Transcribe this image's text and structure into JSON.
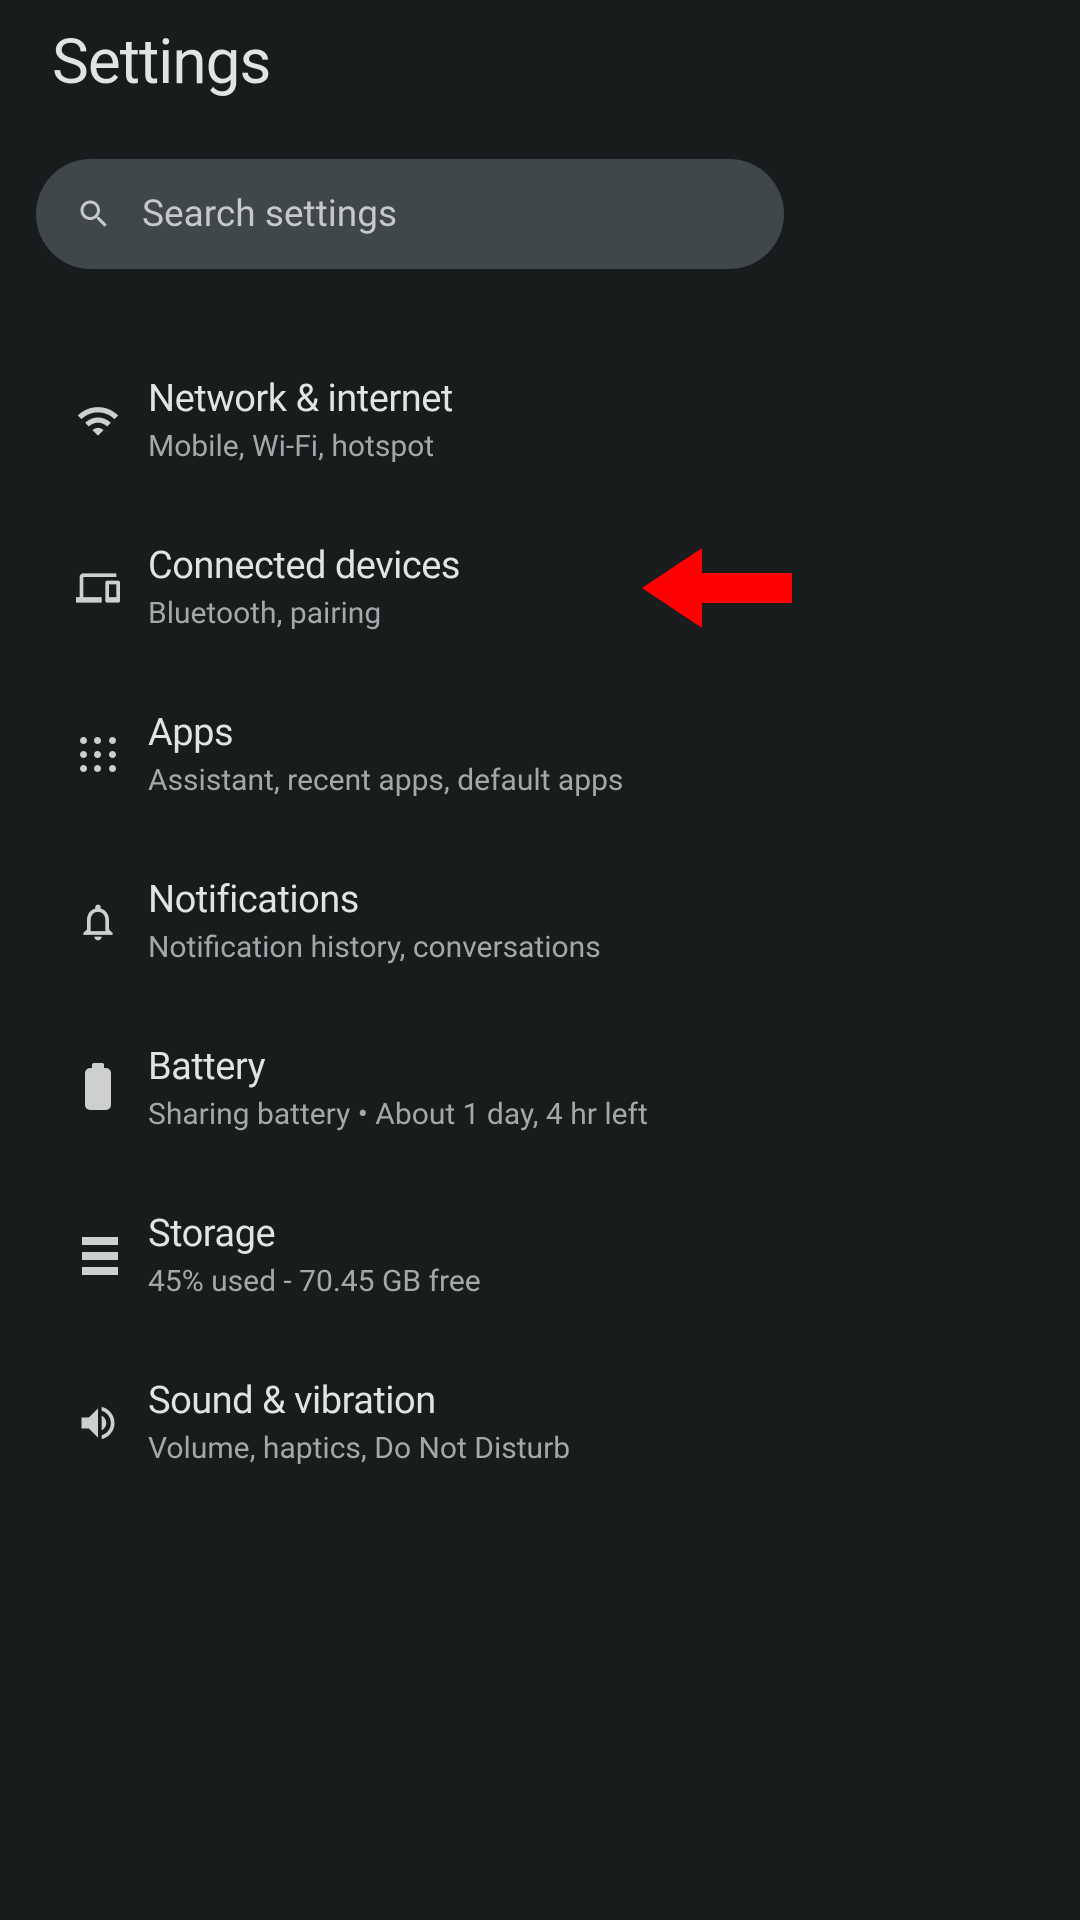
{
  "header": {
    "title": "Settings"
  },
  "search": {
    "placeholder": "Search settings"
  },
  "items": [
    {
      "icon": "wifi-icon",
      "title": "Network & internet",
      "subtitle": "Mobile, Wi-Fi, hotspot"
    },
    {
      "icon": "devices-icon",
      "title": "Connected devices",
      "subtitle": "Bluetooth, pairing"
    },
    {
      "icon": "apps-icon",
      "title": "Apps",
      "subtitle": "Assistant, recent apps, default apps"
    },
    {
      "icon": "bell-icon",
      "title": "Notifications",
      "subtitle": "Notification history, conversations"
    },
    {
      "icon": "battery-icon",
      "title": "Battery",
      "subtitle": "Sharing battery • About 1 day, 4 hr left"
    },
    {
      "icon": "storage-icon",
      "title": "Storage",
      "subtitle": "45% used - 70.45 GB free"
    },
    {
      "icon": "sound-icon",
      "title": "Sound & vibration",
      "subtitle": "Volume, haptics, Do Not Disturb"
    }
  ]
}
